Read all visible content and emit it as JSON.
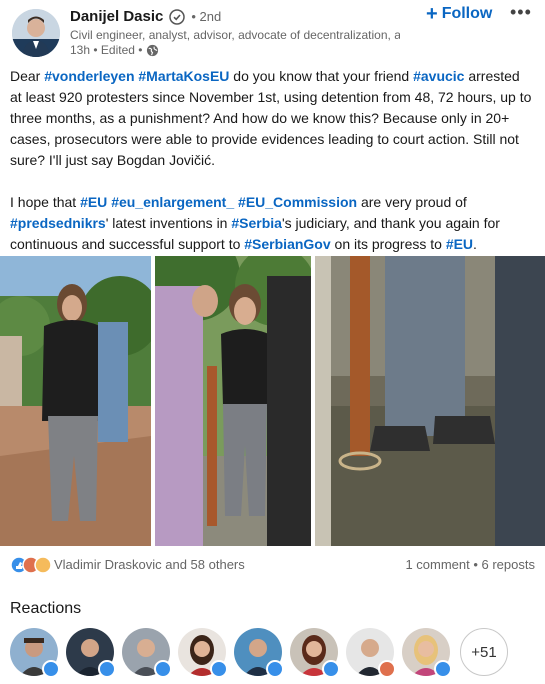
{
  "author": {
    "name": "Danijel Dasic",
    "degree": "• 2nd",
    "headline": "Civil engineer, analyst, advisor, advocate of decentralization, an...",
    "time": "13h • Edited •"
  },
  "actions": {
    "follow_label": "Follow",
    "follow_icon": "+"
  },
  "post": {
    "p1": [
      {
        "t": "Dear ",
        "tag": false
      },
      {
        "t": "#vonderleyen",
        "tag": true
      },
      {
        "t": " ",
        "tag": false
      },
      {
        "t": "#MartaKosEU",
        "tag": true
      },
      {
        "t": " do you know that your friend ",
        "tag": false
      },
      {
        "t": "#avucic",
        "tag": true
      },
      {
        "t": " arrested at least 920 protesters since November 1st, using detention from 48, 72 hours, up to three months, as a punishment? And how do we know this? Because only in 20+ cases, prosecutors were able to provide evidences leading to court action. Still not sure? I'll just say Bogdan Jovičić.",
        "tag": false
      }
    ],
    "p2": [
      {
        "t": "I hope that ",
        "tag": false
      },
      {
        "t": "#EU",
        "tag": true
      },
      {
        "t": " ",
        "tag": false
      },
      {
        "t": "#eu_enlargement_",
        "tag": true
      },
      {
        "t": " ",
        "tag": false
      },
      {
        "t": "#EU_Commission",
        "tag": true
      },
      {
        "t": " are very proud of ",
        "tag": false
      },
      {
        "t": "#predsednikrs",
        "tag": true
      },
      {
        "t": "' latest inventions in ",
        "tag": false
      },
      {
        "t": "#Serbia",
        "tag": true
      },
      {
        "t": "'s judiciary, and thank you again for continuous and successful support to ",
        "tag": false
      },
      {
        "t": "#SerbianGov",
        "tag": true
      },
      {
        "t": " on its progress to ",
        "tag": false
      },
      {
        "t": "#EU",
        "tag": true
      },
      {
        "t": ".",
        "tag": false
      }
    ]
  },
  "social": {
    "reactors_text": "Vladimir Draskovic and 58 others",
    "counts_text": "1 comment • 6 reposts"
  },
  "reactions": {
    "title": "Reactions",
    "more_count": "+51"
  },
  "colors": {
    "link": "#0a66c2",
    "like_badge": "#378fe9"
  }
}
